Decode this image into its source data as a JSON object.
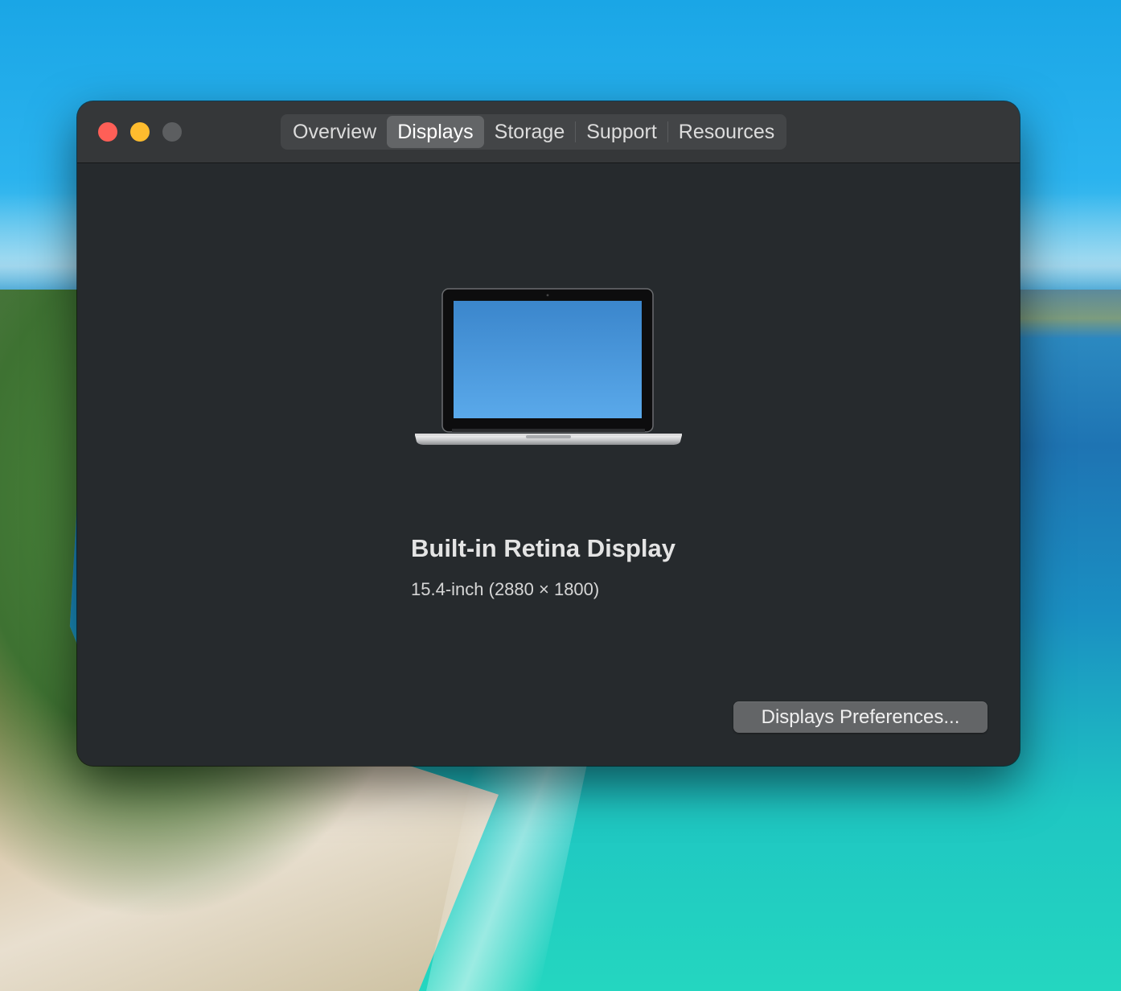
{
  "window": {
    "tabs": [
      {
        "label": "Overview",
        "active": false
      },
      {
        "label": "Displays",
        "active": true
      },
      {
        "label": "Storage",
        "active": false
      },
      {
        "label": "Support",
        "active": false
      },
      {
        "label": "Resources",
        "active": false
      }
    ],
    "traffic_lights": {
      "close_color": "#ff5f57",
      "minimize_color": "#febc2e",
      "zoom_color": "#5c5e60"
    }
  },
  "display": {
    "icon": "laptop-icon",
    "name": "Built-in Retina Display",
    "spec": "15.4-inch (2880 × 1800)"
  },
  "actions": {
    "preferences_label": "Displays Preferences..."
  },
  "colors": {
    "window_bg": "#262a2d",
    "titlebar_bg": "#353739",
    "active_tab_bg": "#636567"
  }
}
